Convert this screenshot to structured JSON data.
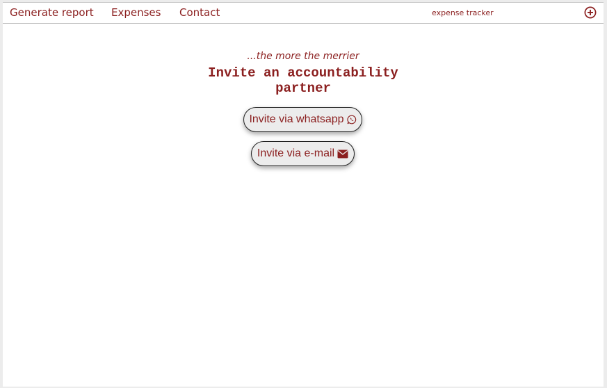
{
  "nav": {
    "links": [
      {
        "label": "Generate report"
      },
      {
        "label": "Expenses"
      },
      {
        "label": "Contact"
      }
    ],
    "brand": "expense tracker",
    "add_icon": "plus-circle-icon"
  },
  "main": {
    "tagline": "...the more the merrier",
    "title": "Invite an accountability partner",
    "buttons": [
      {
        "label": "Invite via whatsapp",
        "icon": "whatsapp-icon"
      },
      {
        "label": "Invite via e-mail",
        "icon": "envelope-icon"
      }
    ]
  },
  "colors": {
    "accent": "#8b1f1f",
    "button_bg": "#ececec",
    "page_bg": "#ffffff"
  }
}
